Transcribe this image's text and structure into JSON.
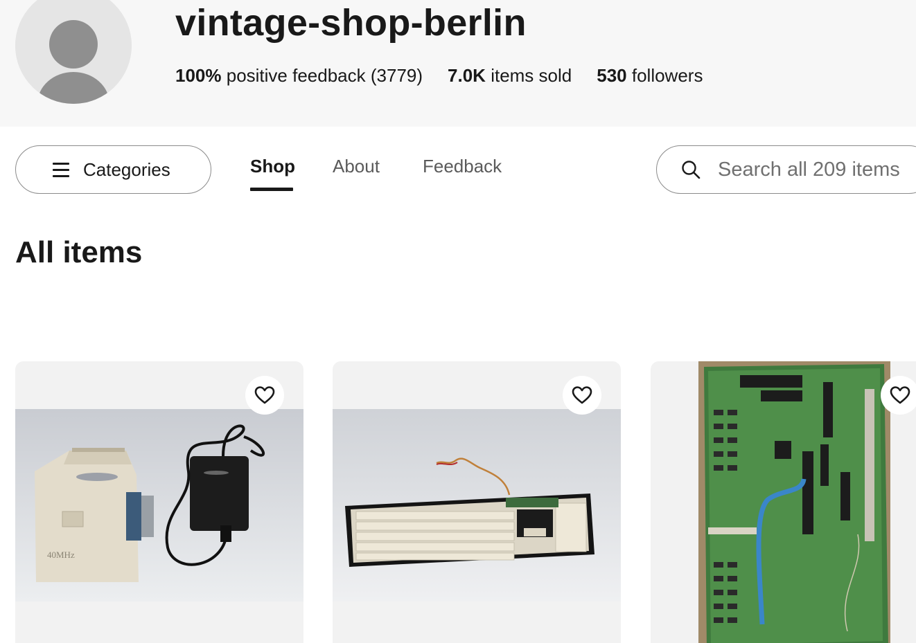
{
  "store": {
    "name": "vintage-shop-berlin",
    "feedback_percent": "100%",
    "feedback_text": "positive feedback (3779)",
    "items_sold_count": "7.0K",
    "items_sold_text": "items sold",
    "followers_count": "530",
    "followers_text": "followers",
    "avatar_icon": "default-user-avatar"
  },
  "nav": {
    "categories_label": "Categories",
    "categories_icon": "hamburger-menu-icon",
    "tabs": [
      {
        "label": "Shop",
        "active": true
      },
      {
        "label": "About",
        "active": false
      },
      {
        "label": "Feedback",
        "active": false
      }
    ],
    "search": {
      "placeholder": "Search all 209 items",
      "icon": "search-icon"
    }
  },
  "main": {
    "title": "All items",
    "items": [
      {
        "image": "Amiga accelerator box with power supply",
        "watchlist_icon": "heart-icon"
      },
      {
        "image": "Beige computer keyboard",
        "watchlist_icon": "heart-icon"
      },
      {
        "image": "Green computer motherboard",
        "watchlist_icon": "heart-icon"
      }
    ]
  },
  "colors": {
    "text": "#191919",
    "muted_text": "#5a5a5a",
    "header_bg": "#f7f7f7",
    "card_bg": "#f2f2f2"
  }
}
